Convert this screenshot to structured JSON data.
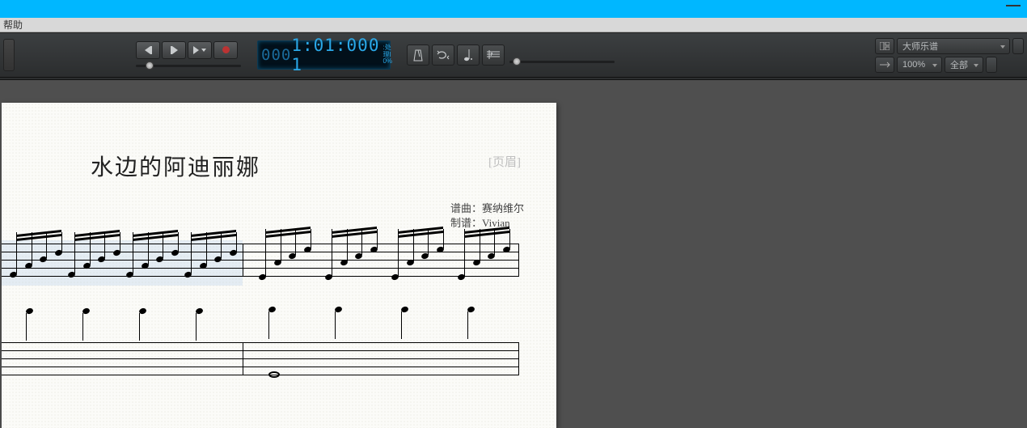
{
  "titlebar": {},
  "menubar": {
    "help": "帮助"
  },
  "transport": {
    "timecode_dim": "000",
    "timecode_bright": "1:01:000  1",
    "processing_label": ":处理I",
    "processing_pct": "0%"
  },
  "right": {
    "layout_dropdown": "大师乐谱",
    "zoom_dropdown": "100%",
    "scope_dropdown": "全部"
  },
  "score": {
    "title": "水边的阿迪丽娜",
    "header_placeholder": "[页眉]",
    "composer_label": "谱曲：",
    "composer_value": "赛纳维尔",
    "transcriber_label": "制谱：",
    "transcriber_value": "Vivian"
  }
}
